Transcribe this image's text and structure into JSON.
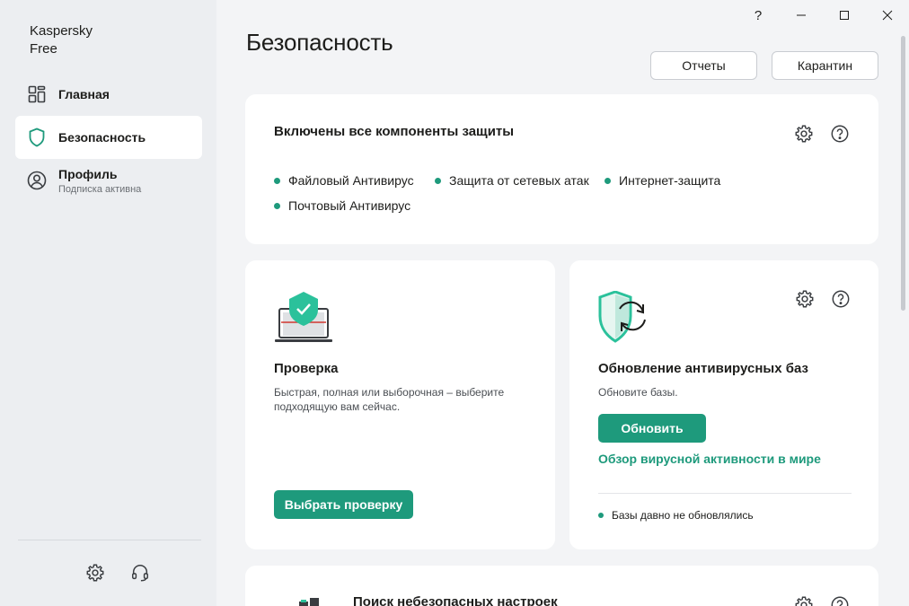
{
  "app": {
    "brand_line1": "Kaspersky",
    "brand_line2": "Free"
  },
  "window": {
    "help": "?",
    "minimize": "—",
    "maximize": "☐",
    "close": "✕"
  },
  "sidebar": {
    "items": [
      {
        "label": "Главная",
        "icon": "grid-icon"
      },
      {
        "label": "Безопасность",
        "icon": "shield-icon"
      },
      {
        "label": "Профиль",
        "sublabel": "Подписка активна",
        "icon": "user-icon"
      }
    ],
    "bottom": {
      "settings_icon": "gear-icon",
      "support_icon": "headset-icon"
    }
  },
  "main": {
    "title": "Безопасность",
    "buttons": {
      "reports": "Отчеты",
      "quarantine": "Карантин"
    },
    "protection_card": {
      "title": "Включены все компоненты защиты",
      "components": [
        "Файловый Антивирус",
        "Защита от сетевых атак",
        "Интернет-защита",
        "Почтовый Антивирус"
      ]
    },
    "scan_card": {
      "title": "Проверка",
      "description_line1": "Быстрая, полная или выборочная – выберите",
      "description_line2": "подходящую вам сейчас.",
      "button": "Выбрать проверку"
    },
    "update_card": {
      "title": "Обновление антивирусных баз",
      "description": "Обновите базы.",
      "button": "Обновить",
      "link": "Обзор вирусной активности в мире",
      "status": "Базы давно не обновлялись"
    },
    "settings_card": {
      "title": "Поиск небезопасных настроек"
    }
  },
  "colors": {
    "accent": "#1e9a7c",
    "background": "#f3f4f6",
    "sidebar": "#eceef1",
    "card": "#ffffff"
  }
}
